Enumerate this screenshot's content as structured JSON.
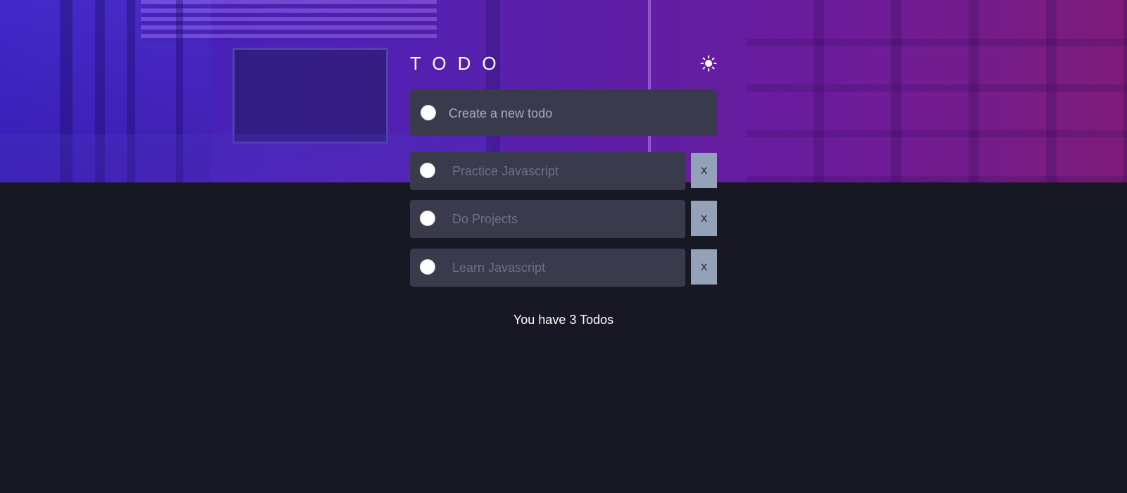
{
  "app": {
    "title": "TODO"
  },
  "new_todo": {
    "placeholder": "Create a new todo"
  },
  "todos": [
    {
      "text": "Practice Javascript",
      "delete_label": "X"
    },
    {
      "text": "Do Projects",
      "delete_label": "X"
    },
    {
      "text": "Learn Javascript",
      "delete_label": "X"
    }
  ],
  "footer": {
    "count_text": "You have 3 Todos"
  },
  "icons": {
    "theme_toggle": "sun-icon"
  },
  "colors": {
    "background": "#181824",
    "card": "#393a4c",
    "delete_button": "#93a2b8",
    "todo_text": "#6f7086",
    "hero_start": "#3a1fc0",
    "hero_end": "#7e1c7a"
  }
}
